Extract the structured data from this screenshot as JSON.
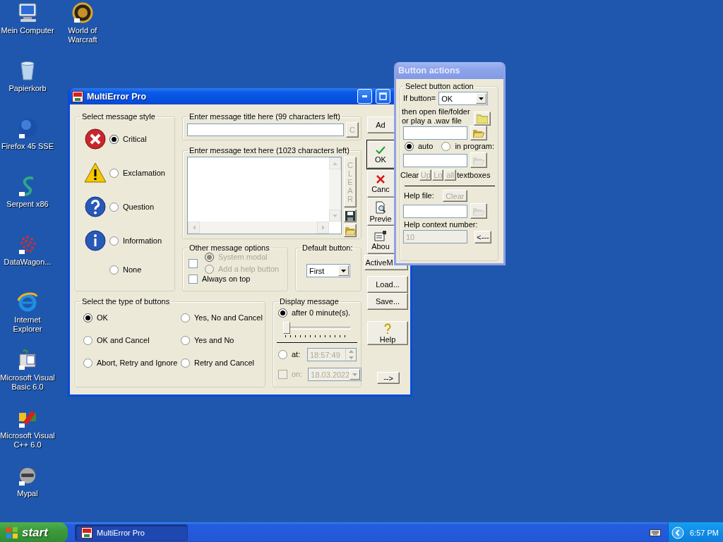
{
  "desktop_icons": [
    {
      "label": "Mein Computer"
    },
    {
      "label": "Papierkorb"
    },
    {
      "label": "Firefox 45 SSE"
    },
    {
      "label": "Serpent x86"
    },
    {
      "label": "DataWagon..."
    },
    {
      "label": "Internet Explorer"
    },
    {
      "label": "Microsoft Visual Basic 6.0"
    },
    {
      "label": "Microsoft Visual C++ 6.0"
    },
    {
      "label": "Mypal"
    },
    {
      "label": "World of Warcraft"
    }
  ],
  "main_window": {
    "title": "MultiError Pro",
    "active": true,
    "style_group": {
      "label": "Select message style",
      "options": [
        {
          "label": "Critical",
          "selected": true
        },
        {
          "label": "Exclamation",
          "selected": false
        },
        {
          "label": "Question",
          "selected": false
        },
        {
          "label": "Information",
          "selected": false
        },
        {
          "label": "None",
          "selected": false
        }
      ]
    },
    "title_group": {
      "label": "Enter message title here (99 characters left)",
      "clear_button": {
        "label": "C",
        "disabled": true
      }
    },
    "text_group": {
      "label": "Enter message text here (1023 characters left)",
      "clear_button": {
        "label": "CLEAR",
        "disabled": true
      }
    },
    "other_options": {
      "label": "Other message options",
      "modal_check": {
        "checked": false
      },
      "options": [
        {
          "label": "System modal",
          "selected": true,
          "disabled": true
        },
        {
          "label": "Add a help button",
          "selected": false,
          "disabled": true
        }
      ],
      "always_on_top": {
        "label": "Always on top",
        "checked": false
      }
    },
    "default_button": {
      "label": "Default button:",
      "value": "First"
    },
    "button_types": {
      "label": "Select the type of buttons",
      "options": [
        {
          "label": "OK",
          "selected": true
        },
        {
          "label": "Yes, No and Cancel",
          "selected": false
        },
        {
          "label": "OK and Cancel",
          "selected": false
        },
        {
          "label": "Yes and No",
          "selected": false
        },
        {
          "label": "Abort, Retry and Ignore",
          "selected": false
        },
        {
          "label": "Retry and Cancel",
          "selected": false
        }
      ]
    },
    "display": {
      "label": "Display message",
      "after": {
        "label": "after 0 minute(s).",
        "selected": true
      },
      "slider": {
        "level": 0
      },
      "at": {
        "label": "at:",
        "selected": false,
        "value": "18:57:49",
        "field_disabled": true
      },
      "on": {
        "label": "on:",
        "checked": false,
        "disabled": true,
        "value": "18.03.2022"
      }
    },
    "side_buttons": [
      {
        "label": "Ad",
        "default": false
      },
      {
        "label": "OK",
        "default": true
      },
      {
        "label": "Canc",
        "default": false
      },
      {
        "label": "Previe",
        "default": false
      },
      {
        "label": "Abou",
        "default": false
      },
      {
        "label": "ActiveM",
        "default": false
      },
      {
        "label": "Load...",
        "default": false
      },
      {
        "label": "Save...",
        "default": false
      },
      {
        "label": "Help",
        "default": false
      },
      {
        "label": "-->",
        "default": false
      }
    ]
  },
  "actions_window": {
    "title": "Button actions",
    "active": false,
    "group_label": "Select button action",
    "if_label": "If button=",
    "if_value": "OK",
    "open_label": "then open file/folder or play a .wav file",
    "modes": [
      {
        "label": "auto",
        "selected": true
      },
      {
        "label": "in program:",
        "selected": false
      }
    ],
    "program_browse_disabled": true,
    "clear_label": "Clear",
    "clear_buttons": [
      {
        "label": "Up",
        "disabled": true
      },
      {
        "label": "Lo",
        "disabled": true
      },
      {
        "label": "all",
        "disabled": true
      }
    ],
    "clear_suffix": "textboxes",
    "help_file_label": "Help file:",
    "help_clear": {
      "label": "Clear",
      "disabled": true
    },
    "help_browse_disabled": true,
    "help_context_label": "Help context number:",
    "help_context": {
      "value": "10",
      "disabled": true
    },
    "back_button": "<---"
  },
  "taskbar": {
    "start": "start",
    "tasks": [
      {
        "label": "MultiError Pro",
        "selected": true
      }
    ],
    "clock": "6:57 PM"
  }
}
